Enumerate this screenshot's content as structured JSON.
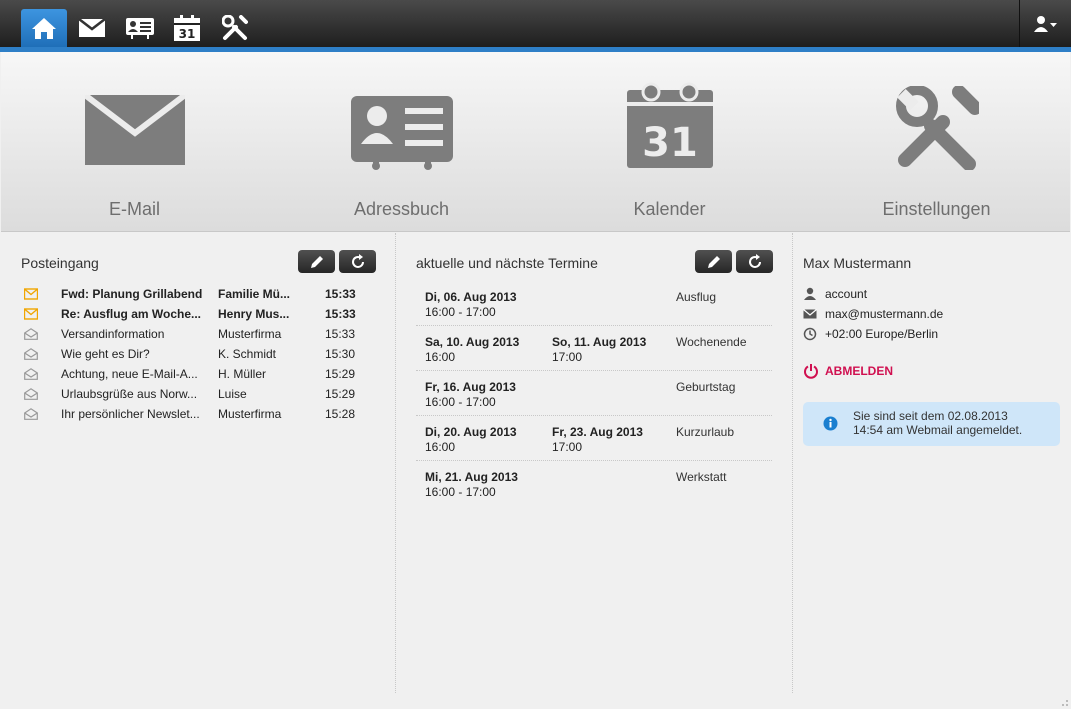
{
  "nav": {
    "items": [
      {
        "name": "home-icon",
        "active": true
      },
      {
        "name": "mail-icon",
        "active": false
      },
      {
        "name": "addressbook-icon",
        "active": false
      },
      {
        "name": "calendar-icon",
        "active": false,
        "badge": "31"
      },
      {
        "name": "settings-icon",
        "active": false
      }
    ],
    "user_menu_icon": "user-icon"
  },
  "launcher": {
    "tiles": [
      {
        "label": "E-Mail",
        "icon": "mail-icon"
      },
      {
        "label": "Adressbuch",
        "icon": "addressbook-icon"
      },
      {
        "label": "Kalender",
        "icon": "calendar-icon",
        "badge": "31"
      },
      {
        "label": "Einstellungen",
        "icon": "settings-icon"
      }
    ]
  },
  "inbox": {
    "title": "Posteingang",
    "messages": [
      {
        "subject": "Fwd: Planung Grillabend",
        "from": "Familie Mü...",
        "time": "15:33",
        "unread": true
      },
      {
        "subject": "Re: Ausflug am Woche...",
        "from": "Henry Mus...",
        "time": "15:33",
        "unread": true
      },
      {
        "subject": "Versandinformation",
        "from": "Musterfirma",
        "time": "15:33",
        "unread": false
      },
      {
        "subject": "Wie geht es Dir?",
        "from": "K. Schmidt",
        "time": "15:30",
        "unread": false
      },
      {
        "subject": "Achtung, neue E-Mail-A...",
        "from": "H. Müller",
        "time": "15:29",
        "unread": false
      },
      {
        "subject": "Urlaubsgrüße aus Norw...",
        "from": "Luise",
        "time": "15:29",
        "unread": false
      },
      {
        "subject": "Ihr persönlicher Newslet...",
        "from": "Musterfirma",
        "time": "15:28",
        "unread": false
      }
    ]
  },
  "calendar": {
    "title": "aktuelle und nächste Termine",
    "events": [
      {
        "start_date": "Di, 06. Aug 2013",
        "start_time": "16:00 - 17:00",
        "end_date": "",
        "end_time": "",
        "title": "Ausflug"
      },
      {
        "start_date": "Sa, 10. Aug 2013",
        "start_time": "16:00",
        "end_date": "So, 11. Aug 2013",
        "end_time": "17:00",
        "title": "Wochenende"
      },
      {
        "start_date": "Fr, 16. Aug 2013",
        "start_time": "16:00 - 17:00",
        "end_date": "",
        "end_time": "",
        "title": "Geburtstag"
      },
      {
        "start_date": "Di, 20. Aug 2013",
        "start_time": "16:00",
        "end_date": "Fr, 23. Aug 2013",
        "end_time": "17:00",
        "title": "Kurzurlaub"
      },
      {
        "start_date": "Mi, 21. Aug 2013",
        "start_time": "16:00 - 17:00",
        "end_date": "",
        "end_time": "",
        "title": "Werkstatt"
      }
    ]
  },
  "user": {
    "name": "Max Mustermann",
    "account": "account",
    "email": "max@mustermann.de",
    "timezone": "+02:00 Europe/Berlin",
    "logout_label": "ABMELDEN",
    "notice": {
      "line1": "Sie sind seit dem 02.08.2013",
      "line2": "14:54 am Webmail angemeldet."
    }
  },
  "colors": {
    "accent": "#2e7fc7",
    "unread_icon": "#f0a500",
    "logout": "#d01050",
    "notice_bg": "#cfe6f9",
    "notice_icon": "#1a7fd0"
  }
}
